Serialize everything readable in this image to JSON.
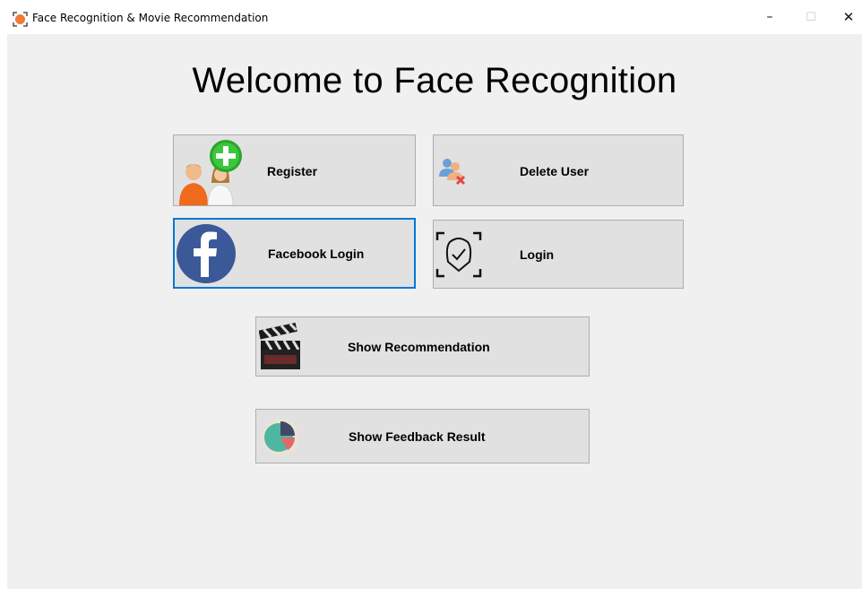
{
  "window": {
    "title": "Face Recognition & Movie Recommendation",
    "minimize_glyph": "–",
    "maximize_glyph": "☐",
    "close_glyph": "✕"
  },
  "heading": "Welcome to Face Recognition",
  "buttons": {
    "register": {
      "label": "Register",
      "icon": "add-user-icon"
    },
    "delete_user": {
      "label": "Delete User",
      "icon": "remove-user-icon"
    },
    "facebook_login": {
      "label": "Facebook Login",
      "icon": "facebook-icon"
    },
    "login": {
      "label": "Login",
      "icon": "face-scan-icon"
    },
    "show_recommendation": {
      "label": "Show Recommendation",
      "icon": "clapperboard-icon"
    },
    "show_feedback": {
      "label": "Show Feedback Result",
      "icon": "pie-chart-icon"
    }
  },
  "colors": {
    "focus_border": "#0078d7",
    "facebook_blue": "#3b5998",
    "button_face": "#e1e1e1",
    "client_bg": "#f0f0f0"
  }
}
